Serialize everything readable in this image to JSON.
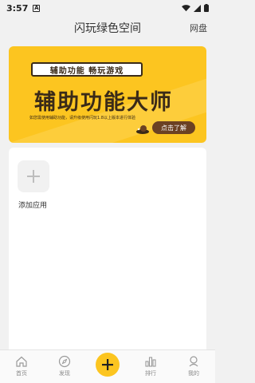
{
  "status": {
    "time": "3:57",
    "a_badge": "A"
  },
  "header": {
    "title": "闪玩绿色空间",
    "netdisk": "网盘"
  },
  "banner": {
    "tag": "辅助功能 畅玩游戏",
    "headline": "辅助功能大师",
    "subline": "如您需使用辅助功能，请升级使用闪玩1.8以上版本进行体验",
    "cta": "点击了解"
  },
  "apps": {
    "add_label": "添加应用"
  },
  "tabs": [
    {
      "label": "首页"
    },
    {
      "label": "发现"
    },
    {
      "label": "排行"
    },
    {
      "label": "我的"
    }
  ],
  "colors": {
    "accent": "#fcc520",
    "dark": "#3a2a18"
  }
}
